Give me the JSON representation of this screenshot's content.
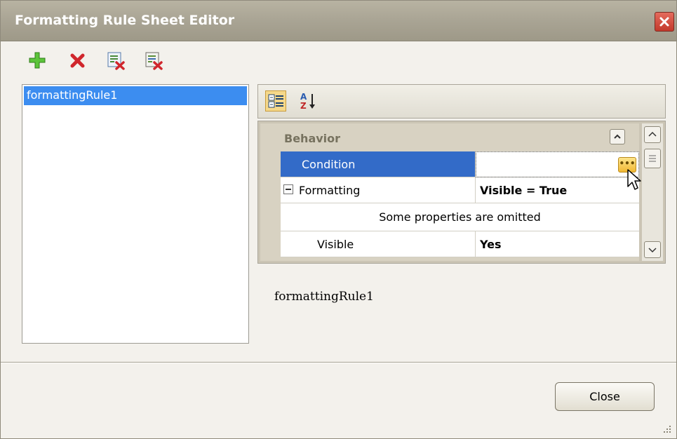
{
  "window": {
    "title": "Formatting Rule Sheet Editor"
  },
  "toolbar": {
    "buttons": [
      {
        "name": "add-rule",
        "icon": "plus-icon"
      },
      {
        "name": "delete-rule",
        "icon": "delete-icon"
      },
      {
        "name": "delete-from-report",
        "icon": "delete-list-icon"
      },
      {
        "name": "purge-rules",
        "icon": "purge-icon"
      }
    ]
  },
  "rules": {
    "items": [
      "formattingRule1"
    ],
    "selected": "formattingRule1"
  },
  "property_grid": {
    "toolbar": {
      "categorized": "categorized-icon",
      "alphabetical": "sort-az-icon"
    },
    "category": "Behavior",
    "rows": {
      "condition": {
        "name": "Condition",
        "value": ""
      },
      "formatting": {
        "name": "Formatting",
        "value": "Visible = True"
      },
      "omitted": "Some properties are omitted",
      "visible": {
        "name": "Visible",
        "value": "Yes"
      }
    }
  },
  "description": "formattingRule1",
  "buttons": {
    "close": "Close"
  },
  "colors": {
    "titlebar": "#a9a494",
    "selection": "#3c8df0",
    "grid_selection": "#336bc8",
    "window_bg": "#f3f1ec"
  }
}
